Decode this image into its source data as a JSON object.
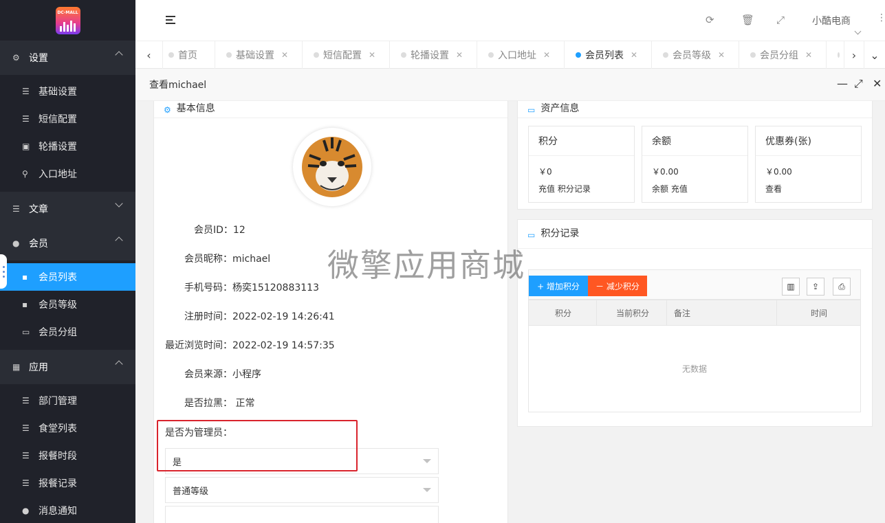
{
  "logo": {
    "text": "DC-MALL"
  },
  "sidebar": {
    "groups": [
      {
        "label": "设置",
        "icon": "gears-icon",
        "expanded": true,
        "items": [
          {
            "label": "基础设置",
            "icon": "list-icon"
          },
          {
            "label": "短信配置",
            "icon": "list-icon"
          },
          {
            "label": "轮播设置",
            "icon": "image-icon"
          },
          {
            "label": "入口地址",
            "icon": "search-icon"
          }
        ]
      },
      {
        "label": "文章",
        "icon": "list-icon",
        "expanded": false,
        "items": []
      },
      {
        "label": "会员",
        "icon": "user-icon",
        "expanded": true,
        "items": [
          {
            "label": "会员列表",
            "icon": "user-card-icon",
            "active": true
          },
          {
            "label": "会员等级",
            "icon": "user-card-icon"
          },
          {
            "label": "会员分组",
            "icon": "id-card-icon"
          }
        ]
      },
      {
        "label": "应用",
        "icon": "grid-icon",
        "expanded": true,
        "items": [
          {
            "label": "部门管理",
            "icon": "list-icon"
          },
          {
            "label": "食堂列表",
            "icon": "list-icon"
          },
          {
            "label": "报餐时段",
            "icon": "list-icon"
          },
          {
            "label": "报餐记录",
            "icon": "list-icon"
          },
          {
            "label": "消息通知",
            "icon": "chat-icon"
          }
        ]
      }
    ]
  },
  "header": {
    "user_name": "小酷电商"
  },
  "tabs": [
    {
      "label": "首页",
      "closable": false
    },
    {
      "label": "基础设置",
      "closable": true
    },
    {
      "label": "短信配置",
      "closable": true
    },
    {
      "label": "轮播设置",
      "closable": true
    },
    {
      "label": "入口地址",
      "closable": true
    },
    {
      "label": "会员列表",
      "closable": true,
      "active": true
    },
    {
      "label": "会员等级",
      "closable": true
    },
    {
      "label": "会员分组",
      "closable": true
    }
  ],
  "dialog": {
    "title": "查看michael",
    "basic": {
      "header": "基本信息",
      "fields": [
        {
          "label": "会员ID：",
          "value": "12"
        },
        {
          "label": "会员昵称：",
          "value": "michael"
        },
        {
          "label": "手机号码：",
          "value": "杨奕15120883113"
        },
        {
          "label": "注册时间：",
          "value": "2022-02-19 14:26:41"
        },
        {
          "label": "最近浏览时间：",
          "value": "2022-02-19 14:57:35"
        },
        {
          "label": "会员来源：",
          "value": "小程序"
        },
        {
          "label": "是否拉黑：",
          "value": " 正常"
        }
      ],
      "admin_label": "是否为管理员：",
      "admin_value": "是",
      "level_value": "普通等级"
    },
    "assets": {
      "header": "资产信息",
      "cards": [
        {
          "title": "积分",
          "value": "￥0",
          "links": "充值 积分记录"
        },
        {
          "title": "余额",
          "value": "￥0.00",
          "links": "余额 充值"
        },
        {
          "title": "优惠券(张)",
          "value": "￥0.00",
          "links": "查看"
        }
      ]
    },
    "points": {
      "header": "积分记录",
      "add_button": "+ 增加积分",
      "reduce_button": "－ 减少积分",
      "columns": [
        "积分",
        "当前积分",
        "备注",
        "时间"
      ],
      "empty_text": "无数据"
    }
  },
  "watermark": "微擎应用商城",
  "colors": {
    "accent": "#1e9fff",
    "danger": "#ff5722",
    "highlight": "#d9232c",
    "sidebar": "#20222a"
  }
}
